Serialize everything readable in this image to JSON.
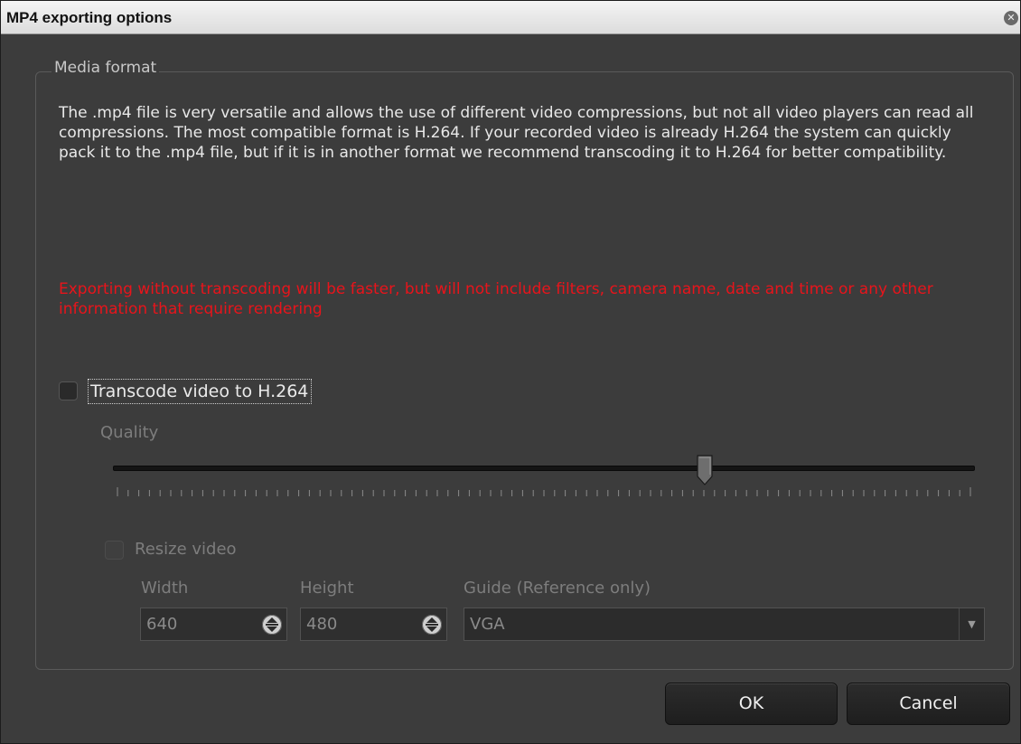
{
  "window": {
    "title": "MP4 exporting options",
    "close_icon": "close-icon"
  },
  "media_format": {
    "legend": "Media format",
    "description": "The .mp4 file is very versatile and allows the use of different video compressions, but not all video players can read all compressions. The most compatible format is H.264. If your recorded video is already H.264 the system can quickly pack it to the .mp4 file, but if it is in another format we recommend transcoding it to H.264 for better compatibility.",
    "warning": "Exporting without transcoding will be faster, but will not include filters, camera name, date and time or any other information that require rendering",
    "warning_color": "#e8141b"
  },
  "transcode": {
    "label": "Transcode video to H.264",
    "checked": false
  },
  "quality": {
    "label": "Quality",
    "value_fraction": 0.69,
    "tick_count": 80
  },
  "resize": {
    "label": "Resize video",
    "checked": false,
    "width_label": "Width",
    "width_value": "640",
    "height_label": "Height",
    "height_value": "480",
    "guide_label": "Guide (Reference only)",
    "guide_value": "VGA"
  },
  "buttons": {
    "ok": "OK",
    "cancel": "Cancel"
  }
}
